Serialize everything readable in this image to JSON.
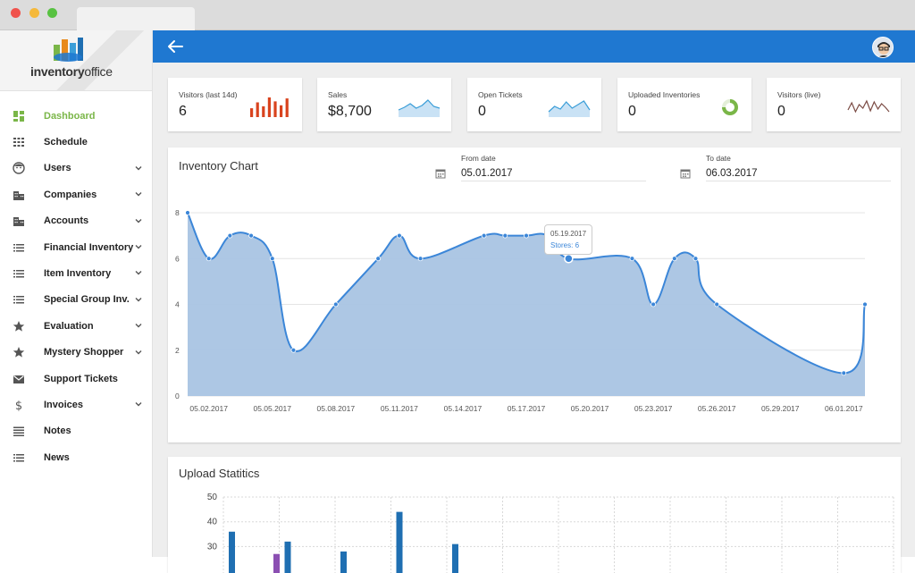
{
  "brand": {
    "name_bold": "inventory",
    "name_rest": "office"
  },
  "sidebar": {
    "items": [
      {
        "label": "Dashboard",
        "icon": "dashboard-icon",
        "active": true,
        "chevron": false
      },
      {
        "label": "Schedule",
        "icon": "grid-icon",
        "active": false,
        "chevron": false
      },
      {
        "label": "Users",
        "icon": "face-icon",
        "active": false,
        "chevron": true
      },
      {
        "label": "Companies",
        "icon": "building-icon",
        "active": false,
        "chevron": true
      },
      {
        "label": "Accounts",
        "icon": "building-icon",
        "active": false,
        "chevron": true
      },
      {
        "label": "Financial Inventory",
        "icon": "list-icon",
        "active": false,
        "chevron": true
      },
      {
        "label": "Item Inventory",
        "icon": "list-icon",
        "active": false,
        "chevron": true
      },
      {
        "label": "Special Group Inv.",
        "icon": "list-icon",
        "active": false,
        "chevron": true
      },
      {
        "label": "Evaluation",
        "icon": "star-icon",
        "active": false,
        "chevron": true
      },
      {
        "label": "Mystery Shopper",
        "icon": "star-icon",
        "active": false,
        "chevron": true
      },
      {
        "label": "Support Tickets",
        "icon": "mail-icon",
        "active": false,
        "chevron": false
      },
      {
        "label": "Invoices",
        "icon": "dollar-icon",
        "active": false,
        "chevron": true
      },
      {
        "label": "Notes",
        "icon": "notes-icon",
        "active": false,
        "chevron": false
      },
      {
        "label": "News",
        "icon": "list-icon",
        "active": false,
        "chevron": false
      }
    ]
  },
  "stats": [
    {
      "label": "Visitors (last 14d)",
      "value": "6",
      "viz": "bars",
      "bars": [
        0.45,
        0.75,
        0.55,
        1.0,
        0.8,
        0.6,
        0.95
      ],
      "color": "#d9431e"
    },
    {
      "label": "Sales",
      "value": "$8,700",
      "viz": "area",
      "color": "#3b9ed8",
      "fill": "#c9e2f5",
      "points": [
        0.4,
        0.55,
        0.75,
        0.5,
        0.65,
        0.95,
        0.6,
        0.5
      ]
    },
    {
      "label": "Open Tickets",
      "value": "0",
      "viz": "area",
      "color": "#3b9ed8",
      "fill": "#c9e2f5",
      "points": [
        0.3,
        0.6,
        0.45,
        0.85,
        0.5,
        0.7,
        0.9,
        0.4
      ]
    },
    {
      "label": "Uploaded Inventories",
      "value": "0",
      "viz": "donut",
      "fraction": 0.75,
      "color": "#7ab648"
    },
    {
      "label": "Visitors (live)",
      "value": "0",
      "viz": "line",
      "color": "#7a4a43",
      "points": [
        0.4,
        0.8,
        0.3,
        0.7,
        0.5,
        0.9,
        0.35,
        0.85,
        0.45,
        0.75,
        0.55,
        0.3
      ]
    }
  ],
  "inventory_chart": {
    "title": "Inventory Chart",
    "from_label": "From date",
    "from_value": "05.01.2017",
    "to_label": "To date",
    "to_value": "06.03.2017",
    "tooltip": {
      "date": "05.19.2017",
      "text": "Stores: 6"
    }
  },
  "upload_chart": {
    "title": "Upload Statitics"
  },
  "chart_data": [
    {
      "type": "area",
      "title": "Inventory Chart",
      "ylim": [
        0,
        8
      ],
      "yticks": [
        "0",
        "2",
        "4",
        "6",
        "8"
      ],
      "xticks": [
        "05.02.2017",
        "05.05.2017",
        "05.08.2017",
        "05.11.2017",
        "05.14.2017",
        "05.17.2017",
        "05.20.2017",
        "05.23.2017",
        "05.26.2017",
        "05.29.2017",
        "06.01.2017"
      ],
      "x": [
        "05.01.2017",
        "05.02.2017",
        "05.03.2017",
        "05.04.2017",
        "05.05.2017",
        "05.06.2017",
        "05.08.2017",
        "05.10.2017",
        "05.11.2017",
        "05.12.2017",
        "05.15.2017",
        "05.16.2017",
        "05.17.2017",
        "05.18.2017",
        "05.19.2017",
        "05.22.2017",
        "05.23.2017",
        "05.24.2017",
        "05.25.2017",
        "05.26.2017",
        "06.01.2017",
        "06.02.2017"
      ],
      "values": [
        8,
        6,
        7,
        7,
        6,
        2,
        4,
        6,
        7,
        6,
        7,
        7,
        7,
        7,
        6,
        6,
        4,
        6,
        6,
        4,
        1,
        4
      ],
      "color": "#3b86d8",
      "fill": "#a9c4e3",
      "grid": true
    },
    {
      "type": "bar",
      "title": "Upload Statitics",
      "ylim": [
        0,
        50
      ],
      "yticks": [
        "30",
        "40",
        "50"
      ],
      "bars": [
        {
          "slot": 0,
          "value": 36,
          "color": "#1f6fb2"
        },
        {
          "slot": 0.8,
          "value": 27,
          "color": "#8b4fb2"
        },
        {
          "slot": 1,
          "value": 32,
          "color": "#1f6fb2"
        },
        {
          "slot": 2,
          "value": 28,
          "color": "#1f6fb2"
        },
        {
          "slot": 3,
          "value": 44,
          "color": "#1f6fb2"
        },
        {
          "slot": 4,
          "value": 31,
          "color": "#1f6fb2"
        }
      ]
    }
  ]
}
